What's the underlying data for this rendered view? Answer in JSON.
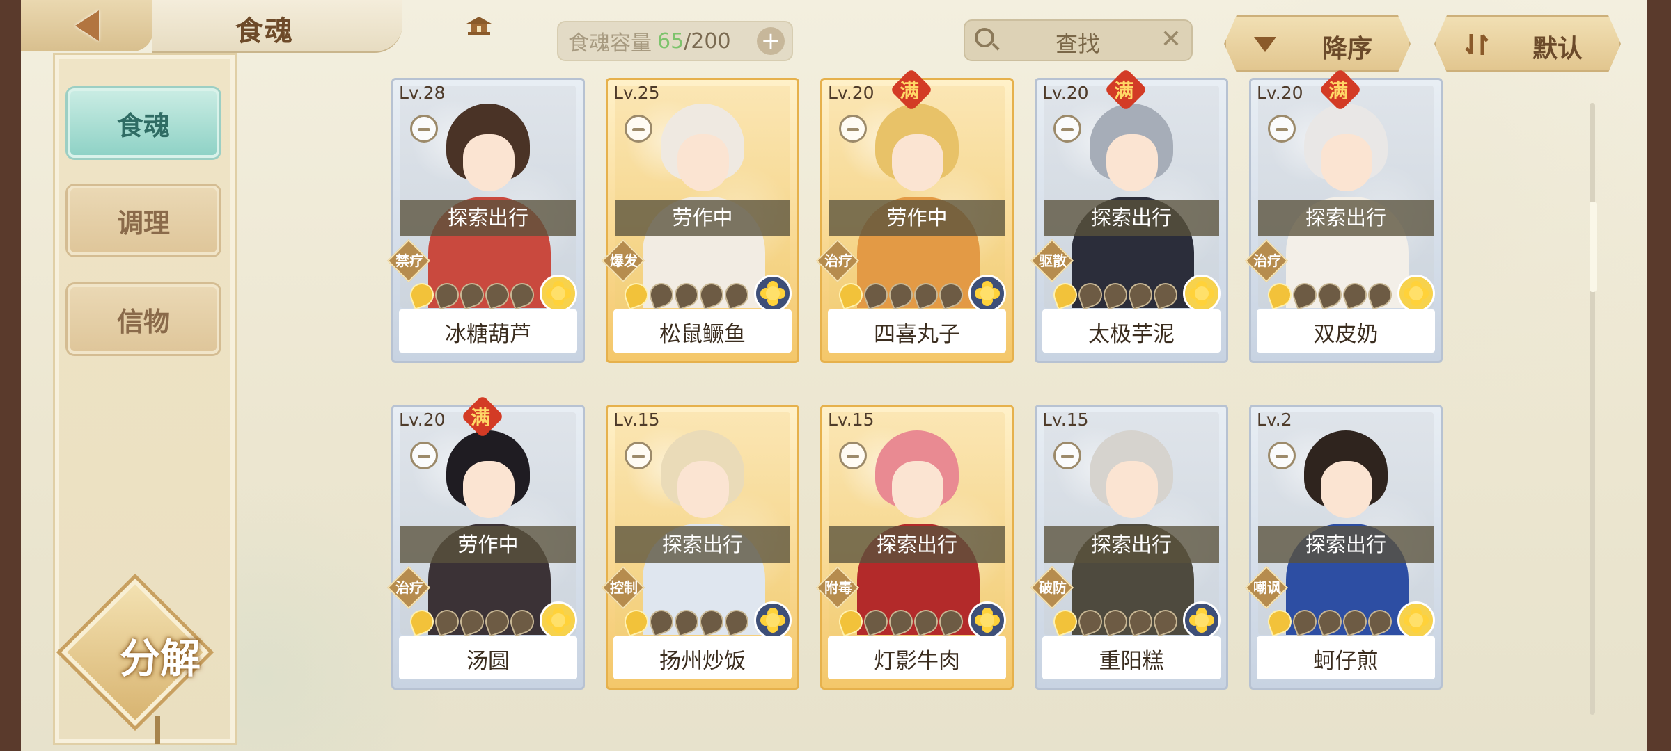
{
  "header": {
    "title": "食魂",
    "capacity": {
      "label": "食魂容量",
      "current": "65",
      "separator": "/",
      "max": "200",
      "add": "+"
    },
    "search": {
      "text": "查找",
      "clear": "✕"
    },
    "sort_desc": "降序",
    "sort_default": "默认"
  },
  "sidebar": {
    "items": [
      {
        "label": "食魂"
      },
      {
        "label": "调理"
      },
      {
        "label": "信物"
      }
    ],
    "decompose": "分解"
  },
  "cards": [
    {
      "level": "Lv.28",
      "full": false,
      "full_label": "",
      "status": "探索出行",
      "role": "禁疗",
      "stars": 1,
      "name": "冰糖葫芦",
      "frame": "blue",
      "element": "yellow",
      "hair": "#4a3326",
      "outfit": "#c9493e"
    },
    {
      "level": "Lv.25",
      "full": false,
      "full_label": "",
      "status": "劳作中",
      "role": "爆发",
      "stars": 1,
      "name": "松鼠鳜鱼",
      "frame": "gold",
      "element": "navy",
      "hair": "#efe9e1",
      "outfit": "#f2ece3"
    },
    {
      "level": "Lv.20",
      "full": true,
      "full_label": "满",
      "status": "劳作中",
      "role": "治疗",
      "stars": 1,
      "name": "四喜丸子",
      "frame": "gold",
      "element": "navy",
      "hair": "#e8c268",
      "outfit": "#e39a45"
    },
    {
      "level": "Lv.20",
      "full": true,
      "full_label": "满",
      "status": "探索出行",
      "role": "驱散",
      "stars": 1,
      "name": "太极芋泥",
      "frame": "blue",
      "element": "yellow",
      "hair": "#a6adb8",
      "outfit": "#2b2d3a"
    },
    {
      "level": "Lv.20",
      "full": true,
      "full_label": "满",
      "status": "探索出行",
      "role": "治疗",
      "stars": 1,
      "name": "双皮奶",
      "frame": "blue",
      "element": "yellow",
      "hair": "#e9e7e6",
      "outfit": "#f3efe8"
    },
    {
      "level": "Lv.20",
      "full": true,
      "full_label": "满",
      "status": "劳作中",
      "role": "治疗",
      "stars": 1,
      "name": "汤圆",
      "frame": "blue",
      "element": "yellow",
      "hair": "#1f1c22",
      "outfit": "#3b3236"
    },
    {
      "level": "Lv.15",
      "full": false,
      "full_label": "",
      "status": "探索出行",
      "role": "控制",
      "stars": 1,
      "name": "扬州炒饭",
      "frame": "gold",
      "element": "navy",
      "hair": "#eadbb8",
      "outfit": "#dfe6ef"
    },
    {
      "level": "Lv.15",
      "full": false,
      "full_label": "",
      "status": "探索出行",
      "role": "附毒",
      "stars": 1,
      "name": "灯影牛肉",
      "frame": "gold",
      "element": "navy",
      "hair": "#e98a92",
      "outfit": "#b32a2a"
    },
    {
      "level": "Lv.15",
      "full": false,
      "full_label": "",
      "status": "探索出行",
      "role": "破防",
      "stars": 1,
      "name": "重阳糕",
      "frame": "blue",
      "element": "navy",
      "hair": "#d6d3ce",
      "outfit": "#4e4a3e"
    },
    {
      "level": "Lv.2",
      "full": false,
      "full_label": "",
      "status": "探索出行",
      "role": "嘲讽",
      "stars": 1,
      "name": "蚵仔煎",
      "frame": "blue",
      "element": "yellow",
      "hair": "#2f241e",
      "outfit": "#2d4ea3"
    }
  ],
  "colors": {
    "accent_teal": "#8fd2c6",
    "gold_frame": "#e6b14c",
    "blue_frame": "#b7c2d2",
    "capacity_green": "#7dc36c",
    "full_badge": "#d33b25"
  }
}
